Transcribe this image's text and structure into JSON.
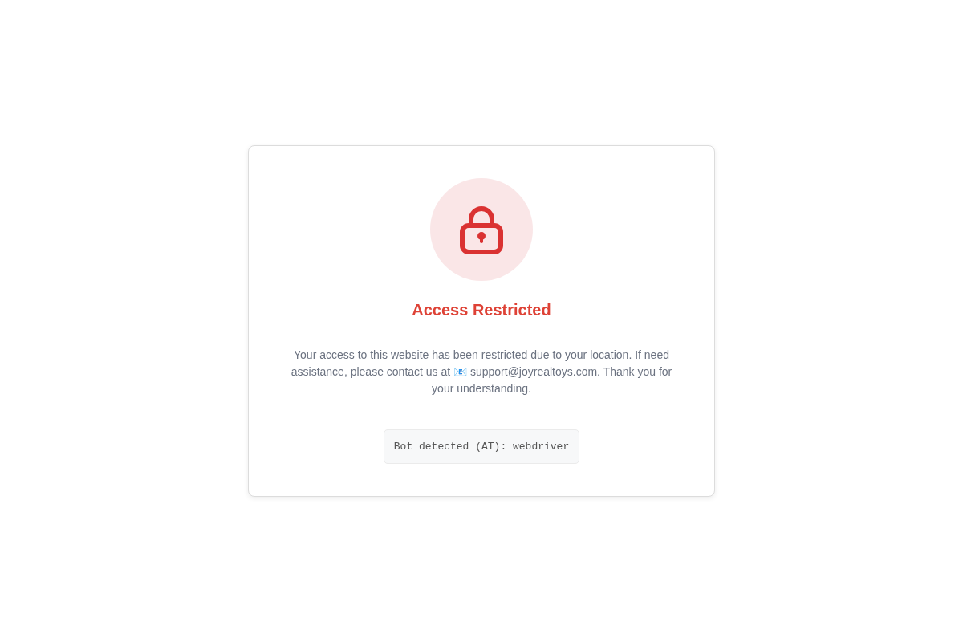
{
  "card": {
    "title": "Access Restricted",
    "message": "Your access to this website has been restricted due to your location. If need assistance, please contact us at 📧 support@joyrealtoys.com. Thank you for your understanding.",
    "detail": "Bot detected (AT): webdriver"
  }
}
